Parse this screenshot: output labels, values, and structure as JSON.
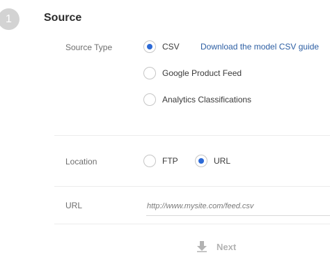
{
  "step": {
    "number": "1",
    "title": "Source"
  },
  "source_type": {
    "label": "Source Type",
    "options": [
      {
        "label": "CSV",
        "selected": true
      },
      {
        "label": "Google Product Feed",
        "selected": false
      },
      {
        "label": "Analytics Classifications",
        "selected": false
      }
    ],
    "guide_link": "Download the model CSV guide"
  },
  "location": {
    "label": "Location",
    "options": [
      {
        "label": "FTP",
        "selected": false
      },
      {
        "label": "URL",
        "selected": true
      }
    ]
  },
  "url": {
    "label": "URL",
    "value": "",
    "placeholder": "http://www.mysite.com/feed.csv"
  },
  "next_button": {
    "label": "Next",
    "icon": "arrow-down-icon",
    "enabled": false
  },
  "colors": {
    "accent": "#2d6ad6",
    "link": "#2c5ea3",
    "disabled": "#b3b3b3",
    "step_circle": "#d3d3d3"
  }
}
